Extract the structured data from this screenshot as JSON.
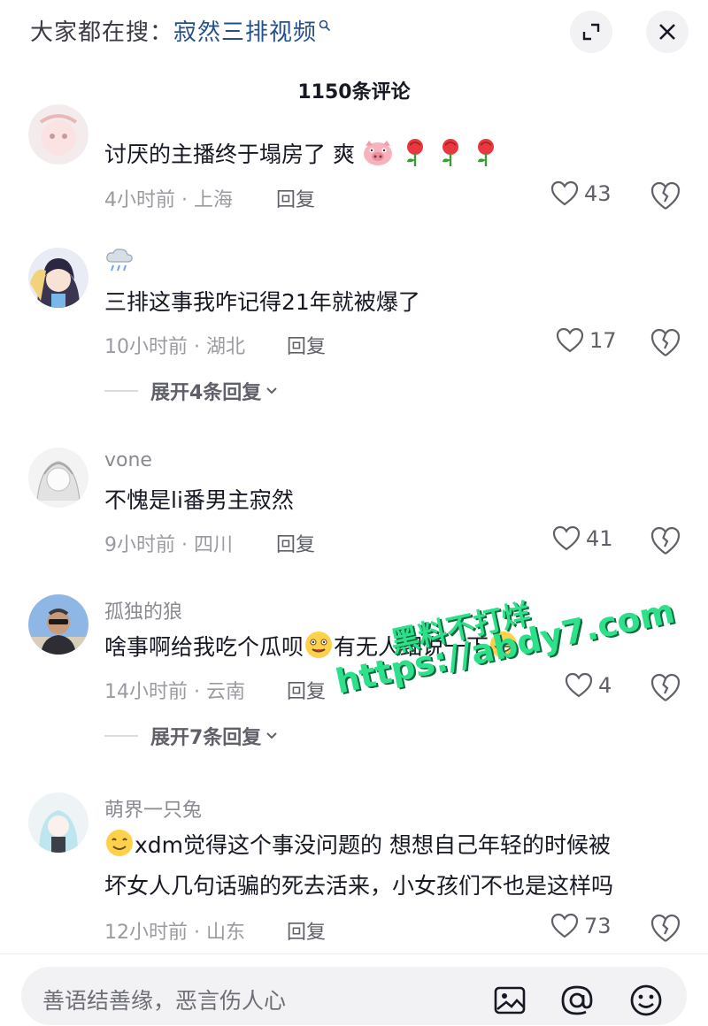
{
  "header": {
    "search_prefix": "大家都在搜：",
    "search_query": "寂然三排视频",
    "comment_count_title": "1150条评论"
  },
  "comments": [
    {
      "nickname": "",
      "text": "讨厌的主播终于塌房了 爽",
      "time_location": "4小时前 · 上海",
      "reply_label": "回复",
      "likes": "43"
    },
    {
      "nickname": "",
      "text": "三排这事我咋记得21年就被爆了",
      "time_location": "10小时前 · 湖北",
      "reply_label": "回复",
      "likes": "17",
      "expand_label": "展开4条回复"
    },
    {
      "nickname": "vone",
      "text": "不愧是li番男主寂然",
      "time_location": "9小时前 · 四川",
      "reply_label": "回复",
      "likes": "41"
    },
    {
      "nickname": "孤独的狼",
      "text_a": "啥事啊给我吃个瓜呗",
      "text_b": "有无人细说一下",
      "time_location": "14小时前 · 云南",
      "reply_label": "回复",
      "likes": "4",
      "expand_label": "展开7条回复"
    },
    {
      "nickname": "萌界一只兔",
      "text_line1": "xdm觉得这个事没问题的 想想自己年轻的时候被",
      "text_line2": "坏女人几句话骗的死去活来，小女孩们不也是这样吗",
      "time_location": "12小时前 · 山东",
      "reply_label": "回复",
      "likes": "73"
    }
  ],
  "watermark": {
    "line1": "黑料不打烊",
    "line2": "https://abdy7.com"
  },
  "input": {
    "placeholder": "善语结善缘，恶言伤人心"
  },
  "icons": {
    "expand": "expand-icon",
    "close": "close-icon",
    "heart": "heart-icon",
    "dislike": "broken-heart-icon",
    "image": "image-icon",
    "mention": "at-icon",
    "emoji": "emoji-icon"
  }
}
